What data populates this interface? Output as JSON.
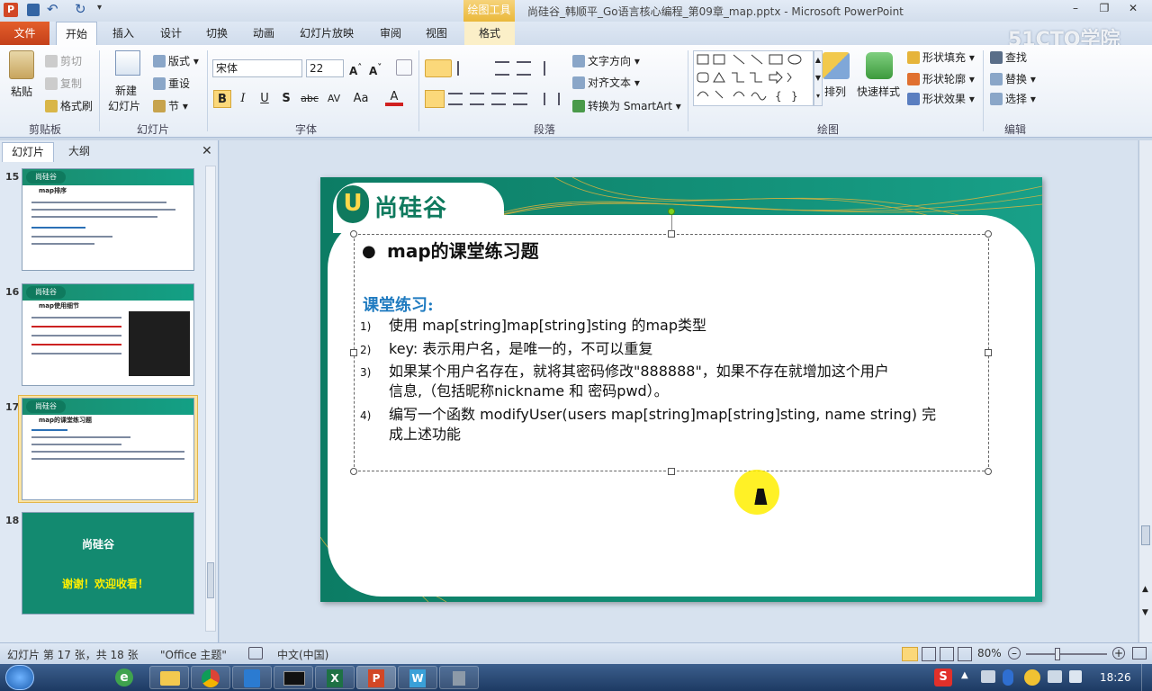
{
  "window": {
    "title": "尚硅谷_韩顺平_Go语言核心编程_第09章_map.pptx - Microsoft PowerPoint",
    "context_tab_group": "绘图工具",
    "watermark": "51CTO学院"
  },
  "tabs": {
    "file": "文件",
    "items": [
      "开始",
      "插入",
      "设计",
      "切换",
      "动画",
      "幻灯片放映",
      "审阅",
      "视图",
      "格式"
    ],
    "active": "开始"
  },
  "ribbon": {
    "clipboard": {
      "paste": "粘贴",
      "cut": "剪切",
      "copy": "复制",
      "format_painter": "格式刷",
      "label": "剪贴板"
    },
    "slides": {
      "new_slide_1": "新建",
      "new_slide_2": "幻灯片",
      "layout": "版式",
      "reset": "重设",
      "section": "节",
      "label": "幻灯片"
    },
    "font": {
      "name": "宋体",
      "size": "22",
      "label": "字体",
      "bold": "B",
      "italic": "I",
      "underline": "U",
      "shadow": "S",
      "strike": "abc",
      "spacing": "AV",
      "case": "Aa",
      "color": "A"
    },
    "paragraph": {
      "text_direction": "文字方向",
      "align_text": "对齐文本",
      "smartart": "转换为 SmartArt",
      "label": "段落"
    },
    "drawing": {
      "arrange": "排列",
      "quick_styles": "快速样式",
      "shape_fill": "形状填充",
      "shape_outline": "形状轮廓",
      "shape_effects": "形状效果",
      "label": "绘图"
    },
    "editing": {
      "find": "查找",
      "replace": "替换",
      "select": "选择",
      "label": "编辑"
    }
  },
  "left_pane": {
    "tabs": [
      "幻灯片",
      "大纲"
    ],
    "slides": [
      {
        "number": "15",
        "title": "map排序"
      },
      {
        "number": "16",
        "title": "map使用细节"
      },
      {
        "number": "17",
        "title": "map的课堂练习题"
      },
      {
        "number": "18",
        "title": "谢谢！欢迎收看！"
      }
    ],
    "selected": "17"
  },
  "slide": {
    "logo_text": "尚硅谷",
    "bullet_title": "map的课堂练习题",
    "section_heading": "课堂练习:",
    "items": [
      {
        "n": "1)",
        "text": "使用 map[string]map[string]sting 的map类型"
      },
      {
        "n": "2)",
        "text": "key: 表示用户名，是唯一的，不可以重复"
      },
      {
        "n": "3)",
        "line1": "如果某个用户名存在，就将其密码修改\"888888\"，如果不存在就增加这个用户",
        "line2": "信息,（包括昵称nickname  和 密码pwd）。"
      },
      {
        "n": "4)",
        "line1": "编写一个函数 modifyUser(users map[string]map[string]sting, name string) 完",
        "line2": "成上述功能"
      }
    ]
  },
  "status": {
    "slide_info": "幻灯片 第 17 张，共 18 张",
    "theme": "\"Office 主题\"",
    "language": "中文(中国)",
    "zoom": "80%"
  },
  "taskbar": {
    "time": "18:26"
  },
  "colors": {
    "teal": "#148d76",
    "heading_blue": "#1f7bc0",
    "file_tab": "#d14d22",
    "highlight": "#ffef00"
  }
}
